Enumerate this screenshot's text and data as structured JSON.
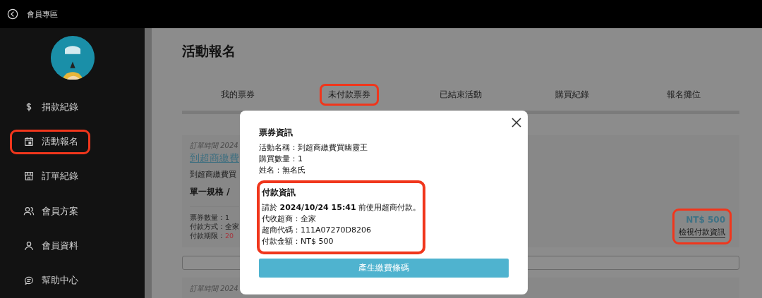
{
  "top_bar": {
    "title": "會員專區"
  },
  "sidebar": {
    "items": [
      {
        "label": "捐款紀錄",
        "highlighted": false
      },
      {
        "label": "活動報名",
        "highlighted": true
      },
      {
        "label": "訂單紀錄",
        "highlighted": false
      },
      {
        "label": "會員方案",
        "highlighted": false
      },
      {
        "label": "會員資料",
        "highlighted": false
      },
      {
        "label": "幫助中心",
        "highlighted": false
      }
    ]
  },
  "page": {
    "title": "活動報名",
    "tabs": [
      {
        "label": "我的票券",
        "highlighted": false
      },
      {
        "label": "未付款票券",
        "highlighted": true
      },
      {
        "label": "已結束活動",
        "highlighted": false
      },
      {
        "label": "購買紀錄",
        "highlighted": false
      },
      {
        "label": "報名攤位",
        "highlighted": false
      }
    ],
    "order": {
      "order_time": "訂單時間 2024",
      "event_link": "到超商繳費",
      "description": "到超商繳費買",
      "spec": "單一規格 /",
      "details": [
        {
          "text": "票券數量：1",
          "kind": "plain"
        },
        {
          "text": "付款方式：全家",
          "kind": "plain"
        },
        {
          "label": "付款期限：",
          "value": "20",
          "kind": "deadline"
        }
      ],
      "price": "NT$ 500",
      "view_link": "檢視付款資訊",
      "price_highlighted": true
    },
    "next_order_time": "訂單時間 2024"
  },
  "dialog": {
    "sections": [
      {
        "title": "票券資訊",
        "highlighted": false,
        "lines": [
          "活動名稱：到超商繳費買幽靈王",
          "購買數量：1",
          "姓名：無名氏"
        ]
      },
      {
        "title": "付款資訊",
        "highlighted": true,
        "lines": [
          "請於 **2024/10/24 15:41** 前使用超商付款。",
          "代收超商：全家",
          "超商代碼：111A07270D8206",
          "付款金額：NT$ 500"
        ]
      }
    ],
    "button": "產生繳費條碼"
  }
}
